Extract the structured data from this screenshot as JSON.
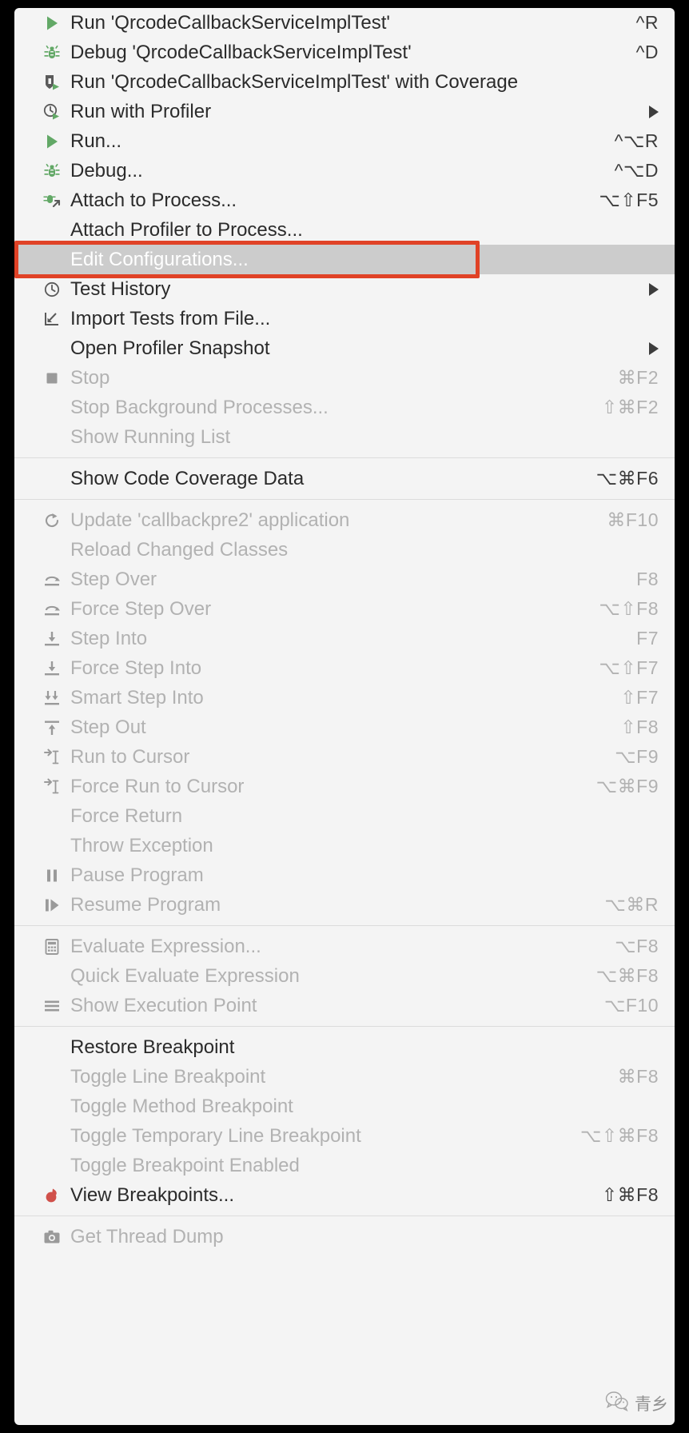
{
  "menu": {
    "groups": [
      {
        "id": "run-group",
        "items": [
          {
            "label": "Run 'QrcodeCallbackServiceImplTest'",
            "shortcut": "^R",
            "icon": "run-green-arrow-icon",
            "state": "enabled"
          },
          {
            "label": "Debug 'QrcodeCallbackServiceImplTest'",
            "shortcut": "^D",
            "icon": "debug-bug-icon",
            "state": "enabled"
          },
          {
            "label": "Run 'QrcodeCallbackServiceImplTest' with Coverage",
            "shortcut": "",
            "icon": "run-with-coverage-icon",
            "state": "enabled"
          },
          {
            "label": "Run with Profiler",
            "shortcut": "",
            "icon": "profiler-clock-icon",
            "state": "enabled",
            "submenu": true
          },
          {
            "label": "Run...",
            "shortcut": "^⌥R",
            "icon": "run-green-arrow-icon",
            "state": "enabled"
          },
          {
            "label": "Debug...",
            "shortcut": "^⌥D",
            "icon": "debug-bug-icon",
            "state": "enabled"
          },
          {
            "label": "Attach to Process...",
            "shortcut": "⌥⇧F5",
            "icon": "attach-process-icon",
            "state": "enabled"
          },
          {
            "label": "Attach Profiler to Process...",
            "shortcut": "",
            "icon": "",
            "state": "enabled"
          },
          {
            "label": "Edit Configurations...",
            "shortcut": "",
            "icon": "",
            "state": "selected"
          },
          {
            "label": "Test History",
            "shortcut": "",
            "icon": "clock-icon",
            "state": "enabled",
            "submenu": true
          },
          {
            "label": "Import Tests from File...",
            "shortcut": "",
            "icon": "import-tests-icon",
            "state": "enabled"
          },
          {
            "label": "Open Profiler Snapshot",
            "shortcut": "",
            "icon": "",
            "state": "enabled",
            "submenu": true
          },
          {
            "label": "Stop",
            "shortcut": "⌘F2",
            "icon": "stop-square-icon",
            "state": "disabled"
          },
          {
            "label": "Stop Background Processes...",
            "shortcut": "⇧⌘F2",
            "icon": "",
            "state": "disabled"
          },
          {
            "label": "Show Running List",
            "shortcut": "",
            "icon": "",
            "state": "disabled"
          }
        ]
      },
      {
        "id": "coverage-group",
        "items": [
          {
            "label": "Show Code Coverage Data",
            "shortcut": "⌥⌘F6",
            "icon": "",
            "state": "enabled"
          }
        ]
      },
      {
        "id": "step-group",
        "items": [
          {
            "label": "Update 'callbackpre2' application",
            "shortcut": "⌘F10",
            "icon": "update-refresh-icon",
            "state": "disabled"
          },
          {
            "label": "Reload Changed Classes",
            "shortcut": "",
            "icon": "",
            "state": "disabled"
          },
          {
            "label": "Step Over",
            "shortcut": "F8",
            "icon": "step-over-icon",
            "state": "disabled"
          },
          {
            "label": "Force Step Over",
            "shortcut": "⌥⇧F8",
            "icon": "step-over-icon",
            "state": "disabled"
          },
          {
            "label": "Step Into",
            "shortcut": "F7",
            "icon": "step-into-icon",
            "state": "disabled"
          },
          {
            "label": "Force Step Into",
            "shortcut": "⌥⇧F7",
            "icon": "step-into-icon",
            "state": "disabled"
          },
          {
            "label": "Smart Step Into",
            "shortcut": "⇧F7",
            "icon": "smart-step-into-icon",
            "state": "disabled"
          },
          {
            "label": "Step Out",
            "shortcut": "⇧F8",
            "icon": "step-out-icon",
            "state": "disabled"
          },
          {
            "label": "Run to Cursor",
            "shortcut": "⌥F9",
            "icon": "run-to-cursor-icon",
            "state": "disabled"
          },
          {
            "label": "Force Run to Cursor",
            "shortcut": "⌥⌘F9",
            "icon": "run-to-cursor-icon",
            "state": "disabled"
          },
          {
            "label": "Force Return",
            "shortcut": "",
            "icon": "",
            "state": "disabled"
          },
          {
            "label": "Throw Exception",
            "shortcut": "",
            "icon": "",
            "state": "disabled"
          },
          {
            "label": "Pause Program",
            "shortcut": "",
            "icon": "pause-icon",
            "state": "disabled"
          },
          {
            "label": "Resume Program",
            "shortcut": "⌥⌘R",
            "icon": "resume-icon",
            "state": "disabled"
          }
        ]
      },
      {
        "id": "evaluate-group",
        "items": [
          {
            "label": "Evaluate Expression...",
            "shortcut": "⌥F8",
            "icon": "calculator-icon",
            "state": "disabled"
          },
          {
            "label": "Quick Evaluate Expression",
            "shortcut": "⌥⌘F8",
            "icon": "",
            "state": "disabled"
          },
          {
            "label": "Show Execution Point",
            "shortcut": "⌥F10",
            "icon": "execution-point-icon",
            "state": "disabled"
          }
        ]
      },
      {
        "id": "breakpoint-group",
        "items": [
          {
            "label": "Restore Breakpoint",
            "shortcut": "",
            "icon": "",
            "state": "enabled"
          },
          {
            "label": "Toggle Line Breakpoint",
            "shortcut": "⌘F8",
            "icon": "",
            "state": "disabled"
          },
          {
            "label": "Toggle Method Breakpoint",
            "shortcut": "",
            "icon": "",
            "state": "disabled"
          },
          {
            "label": "Toggle Temporary Line Breakpoint",
            "shortcut": "⌥⇧⌘F8",
            "icon": "",
            "state": "disabled"
          },
          {
            "label": "Toggle Breakpoint Enabled",
            "shortcut": "",
            "icon": "",
            "state": "disabled"
          },
          {
            "label": "View Breakpoints...",
            "shortcut": "⇧⌘F8",
            "icon": "breakpoint-red-dot-icon",
            "state": "enabled"
          }
        ]
      },
      {
        "id": "thread-group",
        "items": [
          {
            "label": "Get Thread Dump",
            "shortcut": "",
            "icon": "camera-icon",
            "state": "disabled"
          }
        ]
      }
    ]
  },
  "annotation": {
    "target_label": "Edit Configurations...",
    "color": "#e04226"
  },
  "watermark": {
    "text": "青乡",
    "icon": "wechat-icon"
  },
  "colors": {
    "menu_background": "#f4f4f4",
    "selected_background": "#cccccc",
    "enabled_text": "#2b2b2b",
    "disabled_text": "#b2b2b2",
    "accent_green": "#62a866",
    "annotation_red": "#e04226"
  }
}
